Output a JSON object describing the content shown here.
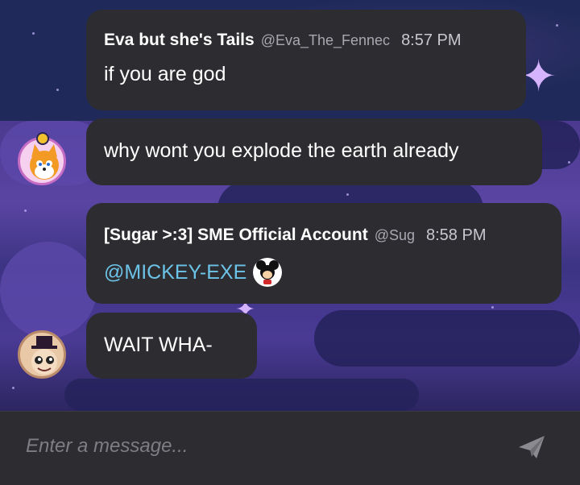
{
  "messages": [
    {
      "author": "Eva but she's Tails",
      "handle": "@Eva_The_Fennec",
      "time": "8:57 PM",
      "text": "if you are god"
    },
    {
      "text": "why wont you explode the earth already"
    },
    {
      "author": "[Sugar >:3] SME Official Account",
      "handle": "@Sug",
      "time": "8:58 PM",
      "mention": "@MICKEY-EXE"
    },
    {
      "text": "WAIT WHA-"
    }
  ],
  "composer": {
    "placeholder": "Enter a message..."
  },
  "icons": {
    "send": "paper-plane-icon",
    "mention_badge": "mickey-sticker-icon"
  },
  "colors": {
    "bubble": "#2d2c30",
    "mention": "#6cc3e8",
    "composer": "#2d2c30"
  }
}
